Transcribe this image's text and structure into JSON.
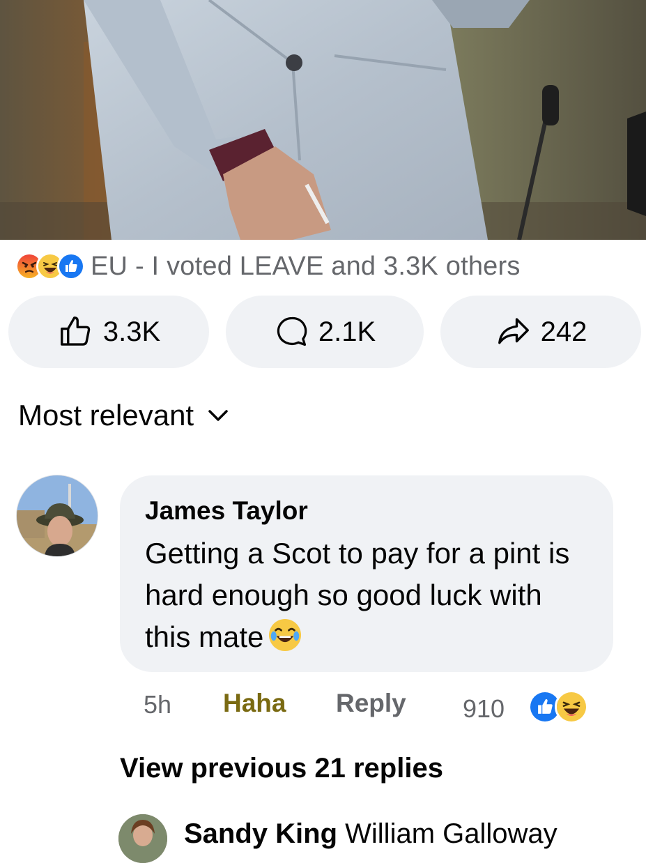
{
  "post": {
    "reaction_summary": "EU - I voted LEAVE and 3.3K others",
    "reaction_icons": [
      "angry-icon",
      "haha-icon",
      "like-icon"
    ],
    "actions": {
      "like_count": "3.3K",
      "comment_count": "2.1K",
      "share_count": "242"
    }
  },
  "sort": {
    "label": "Most relevant"
  },
  "comment": {
    "author": "James Taylor",
    "text": "Getting a Scot to pay for a pint is hard enough so good luck with this mate",
    "emoji": "haha-emoji",
    "time": "5h",
    "reaction_label": "Haha",
    "reply_label": "Reply",
    "reaction_count": "910",
    "reaction_icons": [
      "like-icon",
      "haha-icon"
    ]
  },
  "replies": {
    "view_previous": "View previous 21 replies"
  },
  "next_comment": {
    "author": "Sandy King",
    "text": "William Galloway"
  },
  "colors": {
    "background": "#ffffff",
    "pill": "#f0f2f5",
    "secondary_text": "#65676b",
    "haha_text": "#7a6a12",
    "like_blue": "#1877f2",
    "angry_red": "#e9710f"
  }
}
